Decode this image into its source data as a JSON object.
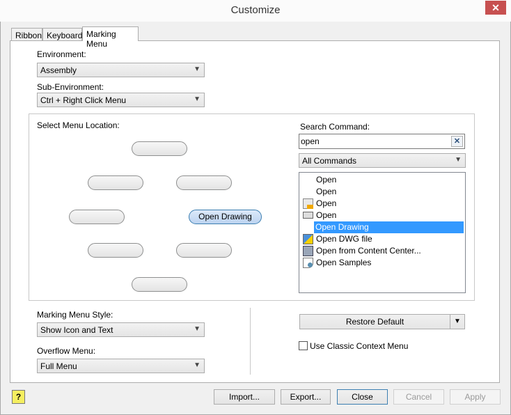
{
  "window": {
    "title": "Customize",
    "close_icon": "close-icon"
  },
  "tabs": [
    {
      "label": "Ribbon"
    },
    {
      "label": "Keyboard"
    },
    {
      "label": "Marking Menu",
      "active": true
    }
  ],
  "environment": {
    "label": "Environment:",
    "value": "Assembly"
  },
  "sub_environment": {
    "label": "Sub-Environment:",
    "value": "Ctrl + Right Click Menu"
  },
  "menu_location": {
    "label": "Select Menu Location:",
    "slots": [
      "",
      "",
      "",
      "",
      "Open Drawing",
      "",
      "",
      ""
    ],
    "selected": "Open Drawing"
  },
  "search": {
    "label": "Search Command:",
    "value": "open",
    "filter": "All Commands",
    "results": [
      {
        "label": "Open",
        "icon": ""
      },
      {
        "label": "Open",
        "icon": ""
      },
      {
        "label": "Open",
        "icon": "open-document-icon"
      },
      {
        "label": "Open",
        "icon": "folder-open-icon"
      },
      {
        "label": "Open Drawing",
        "icon": "",
        "selected": true
      },
      {
        "label": "Open DWG file",
        "icon": "dwg-file-icon"
      },
      {
        "label": "Open from Content Center...",
        "icon": "content-center-icon"
      },
      {
        "label": "Open Samples",
        "icon": "samples-icon"
      }
    ]
  },
  "style": {
    "label": "Marking Menu Style:",
    "value": "Show Icon and Text"
  },
  "overflow": {
    "label": "Overflow Menu:",
    "value": "Full Menu"
  },
  "restore_default": "Restore Default",
  "classic_menu": {
    "label": "Use Classic Context Menu",
    "checked": false
  },
  "buttons": {
    "import": "Import...",
    "export": "Export...",
    "close": "Close",
    "cancel": "Cancel",
    "apply": "Apply"
  },
  "colors": {
    "selection": "#3399ff",
    "close_button": "#c75050"
  }
}
